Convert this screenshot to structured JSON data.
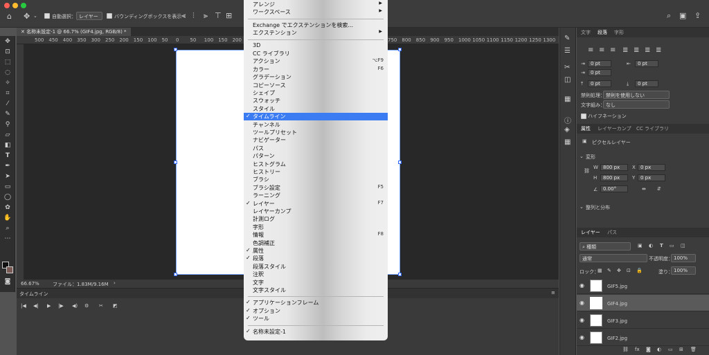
{
  "options_bar": {
    "auto_select_label": "自動選択：",
    "auto_select_target": "レイヤー",
    "bounding_box_label": "バウンディングボックスを表示",
    "chevron": "⌄"
  },
  "document": {
    "tab_title": "名称未設定-1 @ 66.7% (GIF4.jpg, RGB/8) *",
    "ruler_ticks": [
      "500",
      "450",
      "400",
      "350",
      "300",
      "250",
      "200",
      "150",
      "100",
      "50",
      "0",
      "50",
      "100",
      "150",
      "200",
      "250",
      "300",
      "350",
      "400",
      "450",
      "500",
      "550",
      "600",
      "650",
      "700",
      "750",
      "800",
      "850",
      "900",
      "950",
      "1000",
      "1050",
      "1100",
      "1150",
      "1200",
      "1250",
      "1300"
    ],
    "zoom": "66.67%",
    "file_info": "ファイル：1.83M/9.16M",
    "status_arrow": "›"
  },
  "timeline": {
    "title": "タイムライン",
    "menu_icon": "≡"
  },
  "menu": {
    "items": [
      {
        "label": "アレンジ",
        "arrow": "▶",
        "check": "",
        "shortcut": ""
      },
      {
        "label": "ワークスペース",
        "arrow": "▶",
        "check": "",
        "shortcut": ""
      },
      {
        "sep": true
      },
      {
        "label": "Exchange でエクステンションを検索...",
        "check": "",
        "shortcut": "",
        "arrow": ""
      },
      {
        "label": "エクステンション",
        "arrow": "▶",
        "check": "",
        "shortcut": ""
      },
      {
        "sep": true
      },
      {
        "label": "3D",
        "check": "",
        "shortcut": "",
        "arrow": ""
      },
      {
        "label": "CC ライブラリ",
        "check": "",
        "shortcut": "",
        "arrow": ""
      },
      {
        "label": "アクション",
        "check": "",
        "shortcut": "⌥F9",
        "arrow": ""
      },
      {
        "label": "カラー",
        "check": "",
        "shortcut": "F6",
        "arrow": ""
      },
      {
        "label": "グラデーション",
        "check": "",
        "shortcut": "",
        "arrow": ""
      },
      {
        "label": "コピーソース",
        "check": "",
        "shortcut": "",
        "arrow": ""
      },
      {
        "label": "シェイプ",
        "check": "",
        "shortcut": "",
        "arrow": ""
      },
      {
        "label": "スウォッチ",
        "check": "",
        "shortcut": "",
        "arrow": ""
      },
      {
        "label": "スタイル",
        "check": "",
        "shortcut": "",
        "arrow": ""
      },
      {
        "label": "タイムライン",
        "check": "✓",
        "shortcut": "",
        "arrow": "",
        "selected": true
      },
      {
        "label": "チャンネル",
        "check": "",
        "shortcut": "",
        "arrow": ""
      },
      {
        "label": "ツールプリセット",
        "check": "",
        "shortcut": "",
        "arrow": ""
      },
      {
        "label": "ナビゲーター",
        "check": "",
        "shortcut": "",
        "arrow": ""
      },
      {
        "label": "パス",
        "check": "",
        "shortcut": "",
        "arrow": ""
      },
      {
        "label": "パターン",
        "check": "",
        "shortcut": "",
        "arrow": ""
      },
      {
        "label": "ヒストグラム",
        "check": "",
        "shortcut": "",
        "arrow": ""
      },
      {
        "label": "ヒストリー",
        "check": "",
        "shortcut": "",
        "arrow": ""
      },
      {
        "label": "ブラシ",
        "check": "",
        "shortcut": "",
        "arrow": ""
      },
      {
        "label": "ブラシ設定",
        "check": "",
        "shortcut": "F5",
        "arrow": ""
      },
      {
        "label": "ラーニング",
        "check": "",
        "shortcut": "",
        "arrow": ""
      },
      {
        "label": "レイヤー",
        "check": "✓",
        "shortcut": "F7",
        "arrow": ""
      },
      {
        "label": "レイヤーカンプ",
        "check": "",
        "shortcut": "",
        "arrow": ""
      },
      {
        "label": "計測ログ",
        "check": "",
        "shortcut": "",
        "arrow": ""
      },
      {
        "label": "字形",
        "check": "",
        "shortcut": "",
        "arrow": ""
      },
      {
        "label": "情報",
        "check": "",
        "shortcut": "F8",
        "arrow": ""
      },
      {
        "label": "色調補正",
        "check": "",
        "shortcut": "",
        "arrow": ""
      },
      {
        "label": "属性",
        "check": "✓",
        "shortcut": "",
        "arrow": ""
      },
      {
        "label": "段落",
        "check": "✓",
        "shortcut": "",
        "arrow": ""
      },
      {
        "label": "段落スタイル",
        "check": "",
        "shortcut": "",
        "arrow": ""
      },
      {
        "label": "注釈",
        "check": "",
        "shortcut": "",
        "arrow": ""
      },
      {
        "label": "文字",
        "check": "",
        "shortcut": "",
        "arrow": ""
      },
      {
        "label": "文字スタイル",
        "check": "",
        "shortcut": "",
        "arrow": ""
      },
      {
        "sep": true
      },
      {
        "label": "アプリケーションフレーム",
        "check": "✓",
        "shortcut": "",
        "arrow": ""
      },
      {
        "label": "オプション",
        "check": "✓",
        "shortcut": "",
        "arrow": ""
      },
      {
        "label": "ツール",
        "check": "✓",
        "shortcut": "",
        "arrow": ""
      },
      {
        "sep": true
      },
      {
        "label": "名称未設定-1",
        "check": "✓",
        "shortcut": "",
        "arrow": ""
      }
    ]
  },
  "right_panel": {
    "tabs": [
      "文字",
      "段落",
      "字形"
    ],
    "indent_values": [
      "0 pt",
      "0 pt",
      "0 pt",
      "0 pt",
      "0 pt"
    ],
    "kinsoku_label": "禁則処理：",
    "kinsoku_value": "禁則を使用しない",
    "mojigumi_label": "文字組み：",
    "mojigumi_value": "なし",
    "hyphenation_label": "ハイフネーション",
    "props_tabs": [
      "属性",
      "レイヤーカンプ",
      "CC ライブラリ"
    ],
    "pixel_layer": "ピクセルレイヤー",
    "transform_label": "変形",
    "w_label": "W",
    "w_value": "800 px",
    "h_label": "H",
    "h_value": "800 px",
    "x_label": "X",
    "x_value": "0 px",
    "y_label": "Y",
    "y_value": "0 px",
    "angle_value": "0.00°",
    "align_label": "整列と分布",
    "layer_tabs": [
      "レイヤー",
      "パス"
    ],
    "kind_label": "種類",
    "blend_mode": "通常",
    "opacity_label": "不透明度：",
    "opacity_value": "100%",
    "lock_label": "ロック：",
    "fill_label": "塗り：",
    "fill_value": "100%",
    "layers": [
      "GIF5.jpg",
      "GIF4.jpg",
      "GIF3.jpg",
      "GIF2.jpg"
    ],
    "selected_layer": "GIF4.jpg"
  },
  "colors": {
    "menu_selection": "#3b7cf2",
    "close": "#fe5f57",
    "minimize": "#febc2e",
    "maximize": "#28c840"
  }
}
